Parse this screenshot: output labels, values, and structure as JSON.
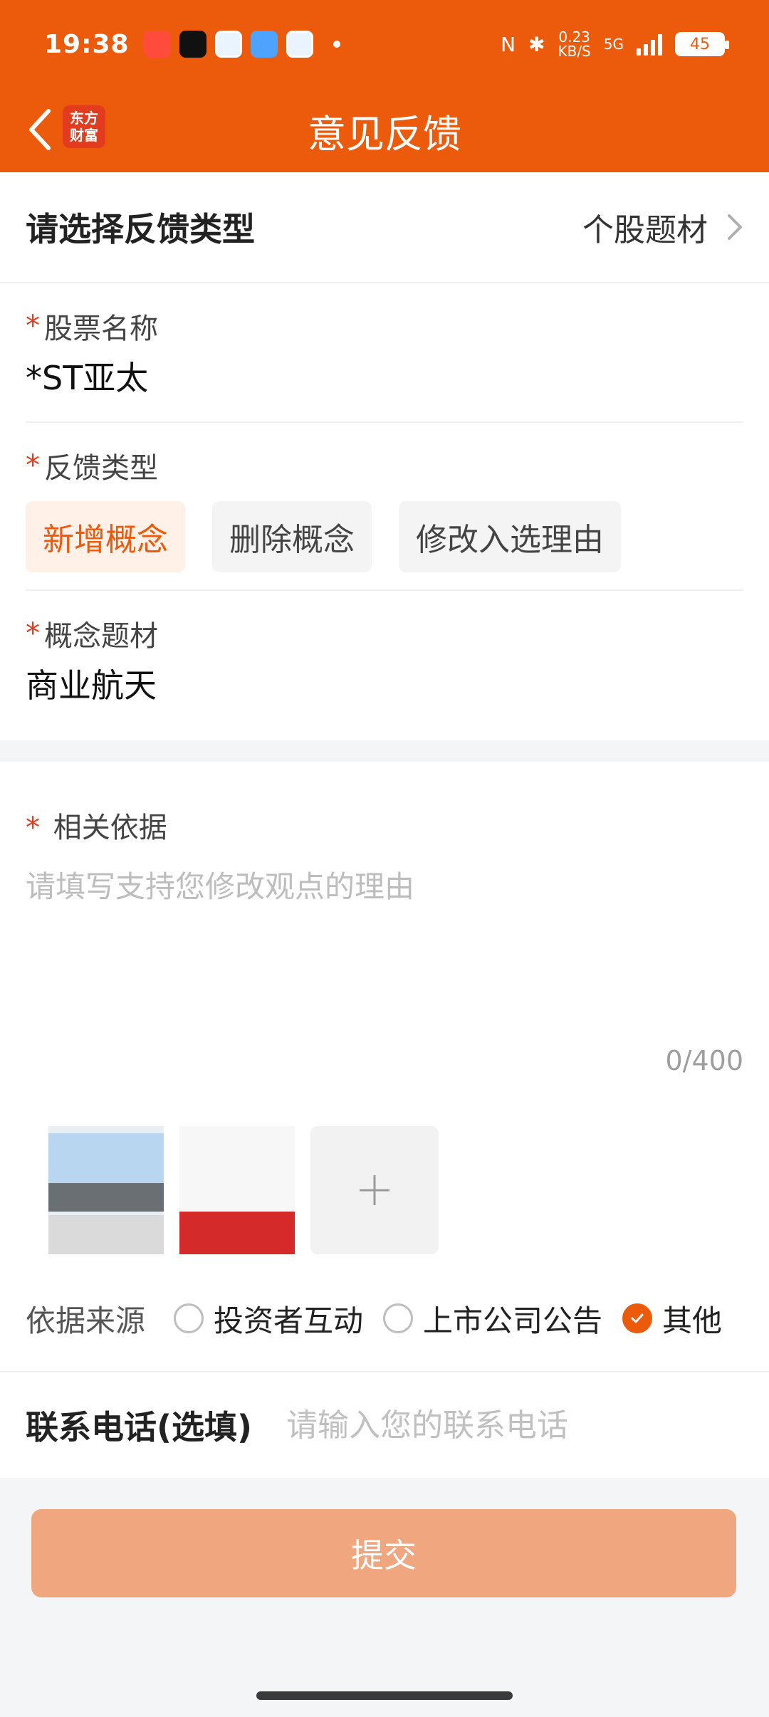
{
  "status": {
    "time": "19:38",
    "net_speed_value": "0.23",
    "net_speed_unit": "KB/S",
    "network": "5G",
    "battery": "45"
  },
  "header": {
    "title": "意见反馈",
    "logo_line1": "东方",
    "logo_line2": "财富"
  },
  "feedback_type": {
    "label": "请选择反馈类型",
    "value": "个股题材"
  },
  "stock": {
    "label": "股票名称",
    "value": "*ST亚太"
  },
  "fb_type": {
    "label": "反馈类型",
    "options": [
      "新增概念",
      "删除概念",
      "修改入选理由"
    ],
    "selected": "新增概念"
  },
  "concept": {
    "label": "概念题材",
    "value": "商业航天"
  },
  "basis": {
    "label": "相关依据",
    "placeholder": "请填写支持您修改观点的理由",
    "counter": "0/400"
  },
  "source": {
    "label": "依据来源",
    "options": [
      "投资者互动",
      "上市公司公告",
      "其他"
    ],
    "selected": "其他"
  },
  "phone": {
    "label": "联系电话(选填)",
    "placeholder": "请输入您的联系电话"
  },
  "submit": {
    "label": "提交"
  },
  "required_mark": "*"
}
